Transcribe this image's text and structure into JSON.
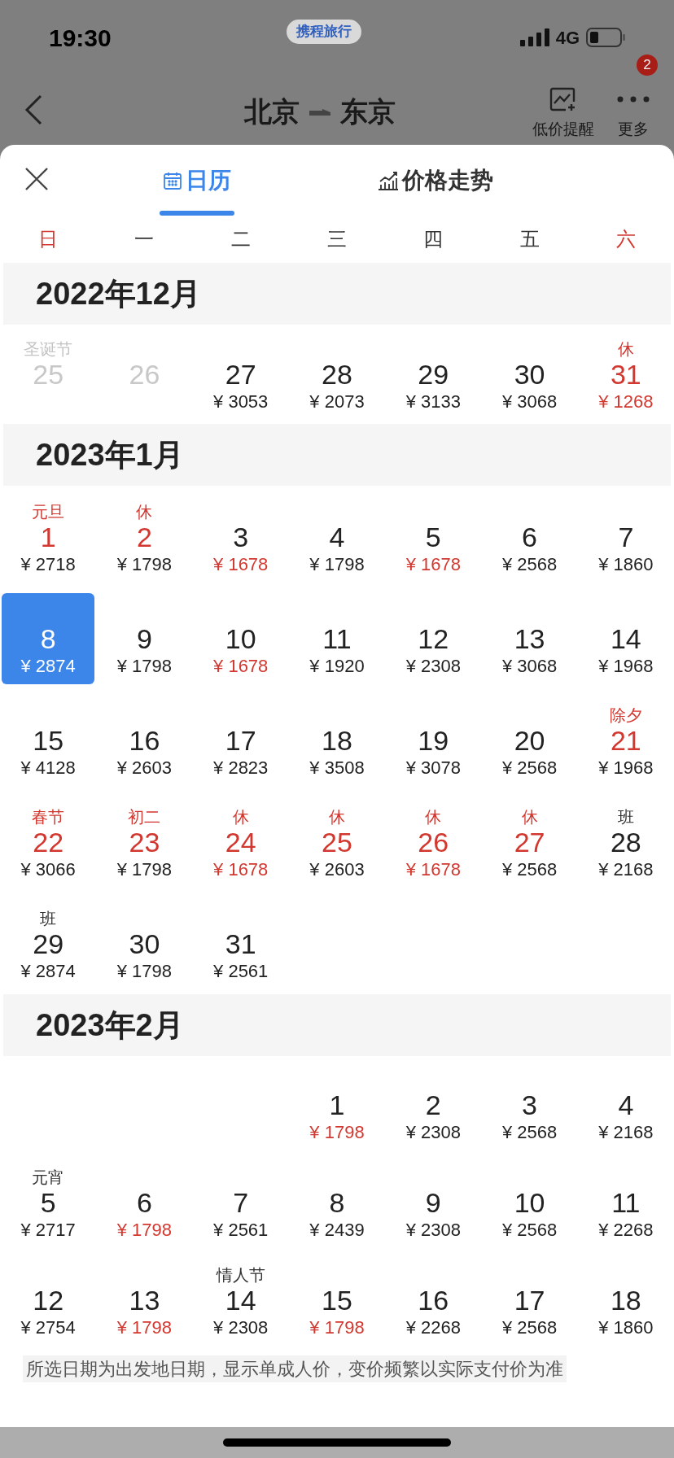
{
  "status_bar": {
    "time": "19:30",
    "app_pill": "携程旅行",
    "network": "4G"
  },
  "nav": {
    "from": "北京",
    "to": "东京",
    "actions": [
      {
        "kind": "alert",
        "label": "低价提醒"
      },
      {
        "kind": "more",
        "label": "更多",
        "badge": "2"
      }
    ]
  },
  "tabs": [
    {
      "kind": "calendar",
      "label": "日历",
      "selected": true
    },
    {
      "kind": "trend",
      "label": "价格走势",
      "selected": false
    }
  ],
  "weekdays": [
    {
      "label": "日",
      "weekend": true
    },
    {
      "label": "一",
      "weekend": false
    },
    {
      "label": "二",
      "weekend": false
    },
    {
      "label": "三",
      "weekend": false
    },
    {
      "label": "四",
      "weekend": false
    },
    {
      "label": "五",
      "weekend": false
    },
    {
      "label": "六",
      "weekend": true
    }
  ],
  "months": [
    {
      "title": "2022年12月",
      "weeks": [
        [
          {
            "kind": "day",
            "label": "圣诞节",
            "day": "25",
            "past": true,
            "selected": false
          },
          {
            "kind": "day",
            "day": "26",
            "past": true,
            "selected": false
          },
          {
            "kind": "day",
            "day": "27",
            "price": "¥ 3053",
            "past": false,
            "holiday": false,
            "low_price": false,
            "selected": false
          },
          {
            "kind": "day",
            "day": "28",
            "price": "¥ 2073",
            "past": false,
            "holiday": false,
            "low_price": false,
            "selected": false
          },
          {
            "kind": "day",
            "day": "29",
            "price": "¥ 3133",
            "past": false,
            "holiday": false,
            "low_price": false,
            "selected": false
          },
          {
            "kind": "day",
            "day": "30",
            "price": "¥ 3068",
            "past": false,
            "holiday": false,
            "low_price": false,
            "selected": false
          },
          {
            "kind": "day",
            "label": "休",
            "day": "31",
            "price": "¥ 1268",
            "past": false,
            "holiday": true,
            "low_price": true,
            "selected": false
          }
        ]
      ]
    },
    {
      "title": "2023年1月",
      "weeks": [
        [
          {
            "kind": "day",
            "label": "元旦",
            "day": "1",
            "price": "¥ 2718",
            "past": false,
            "holiday": true,
            "low_price": false,
            "selected": false
          },
          {
            "kind": "day",
            "label": "休",
            "day": "2",
            "price": "¥ 1798",
            "past": false,
            "holiday": true,
            "low_price": false,
            "selected": false
          },
          {
            "kind": "day",
            "day": "3",
            "price": "¥ 1678",
            "past": false,
            "holiday": false,
            "low_price": true,
            "selected": false
          },
          {
            "kind": "day",
            "day": "4",
            "price": "¥ 1798",
            "past": false,
            "holiday": false,
            "low_price": false,
            "selected": false
          },
          {
            "kind": "day",
            "day": "5",
            "price": "¥ 1678",
            "past": false,
            "holiday": false,
            "low_price": true,
            "selected": false
          },
          {
            "kind": "day",
            "day": "6",
            "price": "¥ 2568",
            "past": false,
            "holiday": false,
            "low_price": false,
            "selected": false
          },
          {
            "kind": "day",
            "day": "7",
            "price": "¥ 1860",
            "past": false,
            "holiday": false,
            "low_price": false,
            "selected": false
          }
        ],
        [
          {
            "kind": "day",
            "day": "8",
            "price": "¥ 2874",
            "selected": true
          },
          {
            "kind": "day",
            "day": "9",
            "price": "¥ 1798",
            "past": false,
            "holiday": false,
            "low_price": false,
            "selected": false
          },
          {
            "kind": "day",
            "day": "10",
            "price": "¥ 1678",
            "past": false,
            "holiday": false,
            "low_price": true,
            "selected": false
          },
          {
            "kind": "day",
            "day": "11",
            "price": "¥ 1920",
            "past": false,
            "holiday": false,
            "low_price": false,
            "selected": false
          },
          {
            "kind": "day",
            "day": "12",
            "price": "¥ 2308",
            "past": false,
            "holiday": false,
            "low_price": false,
            "selected": false
          },
          {
            "kind": "day",
            "day": "13",
            "price": "¥ 3068",
            "past": false,
            "holiday": false,
            "low_price": false,
            "selected": false
          },
          {
            "kind": "day",
            "day": "14",
            "price": "¥ 1968",
            "past": false,
            "holiday": false,
            "low_price": false,
            "selected": false
          }
        ],
        [
          {
            "kind": "day",
            "day": "15",
            "price": "¥ 4128",
            "past": false,
            "holiday": false,
            "low_price": false,
            "selected": false
          },
          {
            "kind": "day",
            "day": "16",
            "price": "¥ 2603",
            "past": false,
            "holiday": false,
            "low_price": false,
            "selected": false
          },
          {
            "kind": "day",
            "day": "17",
            "price": "¥ 2823",
            "past": false,
            "holiday": false,
            "low_price": false,
            "selected": false
          },
          {
            "kind": "day",
            "day": "18",
            "price": "¥ 3508",
            "past": false,
            "holiday": false,
            "low_price": false,
            "selected": false
          },
          {
            "kind": "day",
            "day": "19",
            "price": "¥ 3078",
            "past": false,
            "holiday": false,
            "low_price": false,
            "selected": false
          },
          {
            "kind": "day",
            "day": "20",
            "price": "¥ 2568",
            "past": false,
            "holiday": false,
            "low_price": false,
            "selected": false
          },
          {
            "kind": "day",
            "label": "除夕",
            "day": "21",
            "price": "¥ 1968",
            "past": false,
            "holiday": true,
            "low_price": false,
            "selected": false
          }
        ],
        [
          {
            "kind": "day",
            "label": "春节",
            "day": "22",
            "price": "¥ 3066",
            "past": false,
            "holiday": true,
            "low_price": false,
            "selected": false
          },
          {
            "kind": "day",
            "label": "初二",
            "day": "23",
            "price": "¥ 1798",
            "past": false,
            "holiday": true,
            "low_price": false,
            "selected": false
          },
          {
            "kind": "day",
            "label": "休",
            "day": "24",
            "price": "¥ 1678",
            "past": false,
            "holiday": true,
            "low_price": true,
            "selected": false
          },
          {
            "kind": "day",
            "label": "休",
            "day": "25",
            "price": "¥ 2603",
            "past": false,
            "holiday": true,
            "low_price": false,
            "selected": false
          },
          {
            "kind": "day",
            "label": "休",
            "day": "26",
            "price": "¥ 1678",
            "past": false,
            "holiday": true,
            "low_price": true,
            "selected": false
          },
          {
            "kind": "day",
            "label": "休",
            "day": "27",
            "price": "¥ 2568",
            "past": false,
            "holiday": true,
            "low_price": false,
            "selected": false
          },
          {
            "kind": "day",
            "label": "班",
            "day": "28",
            "price": "¥ 2168",
            "past": false,
            "holiday": false,
            "low_price": false,
            "selected": false
          }
        ],
        [
          {
            "kind": "day",
            "label": "班",
            "day": "29",
            "price": "¥ 2874",
            "past": false,
            "holiday": false,
            "low_price": false,
            "selected": false
          },
          {
            "kind": "day",
            "day": "30",
            "price": "¥ 1798",
            "past": false,
            "holiday": false,
            "low_price": false,
            "selected": false
          },
          {
            "kind": "day",
            "day": "31",
            "price": "¥ 2561",
            "past": false,
            "holiday": false,
            "low_price": false,
            "selected": false
          }
        ]
      ]
    },
    {
      "title": "2023年2月",
      "weeks": [
        [
          {
            "kind": "blank"
          },
          {
            "kind": "blank"
          },
          {
            "kind": "blank"
          },
          {
            "kind": "day",
            "day": "1",
            "price": "¥ 1798",
            "past": false,
            "holiday": false,
            "low_price": true,
            "selected": false
          },
          {
            "kind": "day",
            "day": "2",
            "price": "¥ 2308",
            "past": false,
            "holiday": false,
            "low_price": false,
            "selected": false
          },
          {
            "kind": "day",
            "day": "3",
            "price": "¥ 2568",
            "past": false,
            "holiday": false,
            "low_price": false,
            "selected": false
          },
          {
            "kind": "day",
            "day": "4",
            "price": "¥ 2168",
            "past": false,
            "holiday": false,
            "low_price": false,
            "selected": false
          }
        ],
        [
          {
            "kind": "day",
            "label": "元宵",
            "day": "5",
            "price": "¥ 2717",
            "past": false,
            "holiday": false,
            "low_price": false,
            "selected": false
          },
          {
            "kind": "day",
            "day": "6",
            "price": "¥ 1798",
            "past": false,
            "holiday": false,
            "low_price": true,
            "selected": false
          },
          {
            "kind": "day",
            "day": "7",
            "price": "¥ 2561",
            "past": false,
            "holiday": false,
            "low_price": false,
            "selected": false
          },
          {
            "kind": "day",
            "day": "8",
            "price": "¥ 2439",
            "past": false,
            "holiday": false,
            "low_price": false,
            "selected": false
          },
          {
            "kind": "day",
            "day": "9",
            "price": "¥ 2308",
            "past": false,
            "holiday": false,
            "low_price": false,
            "selected": false
          },
          {
            "kind": "day",
            "day": "10",
            "price": "¥ 2568",
            "past": false,
            "holiday": false,
            "low_price": false,
            "selected": false
          },
          {
            "kind": "day",
            "day": "11",
            "price": "¥ 2268",
            "past": false,
            "holiday": false,
            "low_price": false,
            "selected": false
          }
        ],
        [
          {
            "kind": "day",
            "day": "12",
            "price": "¥ 2754",
            "past": false,
            "holiday": false,
            "low_price": false,
            "selected": false
          },
          {
            "kind": "day",
            "day": "13",
            "price": "¥ 1798",
            "past": false,
            "holiday": false,
            "low_price": true,
            "selected": false
          },
          {
            "kind": "day",
            "label": "情人节",
            "day": "14",
            "price": "¥ 2308",
            "past": false,
            "holiday": false,
            "low_price": false,
            "selected": false
          },
          {
            "kind": "day",
            "day": "15",
            "price": "¥ 1798",
            "past": false,
            "holiday": false,
            "low_price": true,
            "selected": false
          },
          {
            "kind": "day",
            "day": "16",
            "price": "¥ 2268",
            "past": false,
            "holiday": false,
            "low_price": false,
            "selected": false
          },
          {
            "kind": "day",
            "day": "17",
            "price": "¥ 2568",
            "past": false,
            "holiday": false,
            "low_price": false,
            "selected": false
          },
          {
            "kind": "day",
            "day": "18",
            "price": "¥ 1860",
            "past": false,
            "holiday": false,
            "low_price": false,
            "selected": false
          }
        ]
      ]
    }
  ],
  "note": "所选日期为出发地日期，显示单成人价，变价频繁以实际支付价为准"
}
